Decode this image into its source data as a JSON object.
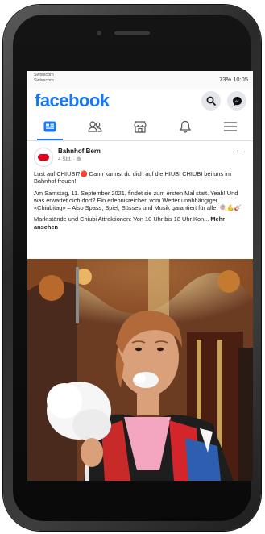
{
  "status_bar": {
    "carrier_line1": "Swisscom",
    "carrier_line2": "Swisscom",
    "right": "73% 10:05"
  },
  "app": {
    "logo_text": "facebook"
  },
  "navbar": {
    "tabs": [
      "home",
      "friends",
      "marketplace",
      "notifications",
      "menu"
    ]
  },
  "post": {
    "author": "Bahnhof Bern",
    "time": "4 Std.",
    "paragraph1": "Lust auf CHIUBI?🔴 Dann kannst du dich auf die HIUBI CHIUBI bei uns im Bahnhof freuen!",
    "paragraph2": "Am Samstag, 11. September 2021, findet sie zum ersten Mal statt. Yeah! Und was erwartet dich dort? Ein erlebnisreicher, vom Wetter unabhängiger «Chiubitag» – Also Spass, Spiel, Süsses und Musik garantiert für alle. 🍭💪🎸",
    "paragraph3": "Marktstände und Chiubi Attraktionen: Von 10 Uhr bis 18 Uhr Kon...",
    "see_more": "Mehr ansehen"
  },
  "colors": {
    "brand": "#1877f2",
    "bg": "#ffffff"
  }
}
